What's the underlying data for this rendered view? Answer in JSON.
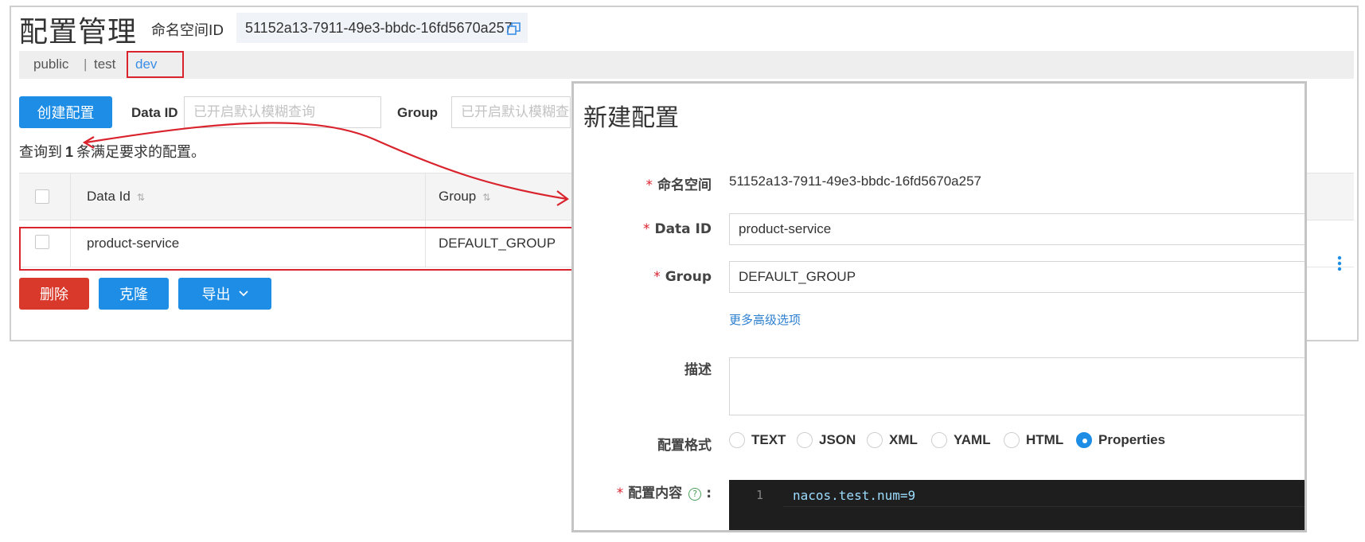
{
  "page": {
    "title": "配置管理",
    "namespace_label": "命名空间ID",
    "namespace_id": "51152a13-7911-49e3-bbdc-16fd5670a257"
  },
  "namespace_tabs": [
    {
      "label": "public",
      "active": false
    },
    {
      "label": "test",
      "active": false
    },
    {
      "label": "dev",
      "active": true
    }
  ],
  "toolbar": {
    "create_button": "创建配置",
    "data_id_label": "Data ID",
    "data_id_placeholder": "已开启默认模糊查询",
    "group_label": "Group",
    "group_placeholder": "已开启默认模糊查询"
  },
  "results": {
    "prefix": "查询到",
    "count": "1",
    "suffix": "条满足要求的配置。"
  },
  "table": {
    "headers": [
      "Data Id",
      "Group"
    ],
    "rows": [
      {
        "data_id": "product-service",
        "group": "DEFAULT_GROUP"
      }
    ]
  },
  "bulk_actions": {
    "delete": "删除",
    "clone": "克隆",
    "export": "导出"
  },
  "dialog": {
    "title": "新建配置",
    "namespace_label": "命名空间",
    "namespace_value": "51152a13-7911-49e3-bbdc-16fd5670a257",
    "data_id_label": "Data ID",
    "data_id_value": "product-service",
    "group_label": "Group",
    "group_value": "DEFAULT_GROUP",
    "advanced_link": "更多高级选项",
    "description_label": "描述",
    "format_label": "配置格式",
    "formats": [
      "TEXT",
      "JSON",
      "XML",
      "YAML",
      "HTML",
      "Properties"
    ],
    "selected_format": "Properties",
    "content_label": "配置内容",
    "content_colon": ":",
    "help_symbol": "?",
    "editor": {
      "line_number": "1",
      "line_text": "nacos.test.num=9"
    }
  },
  "icons": {
    "copy": "copy-icon",
    "sort": "sort-icon",
    "chevron": "chevron-down-icon",
    "more": "more-vertical-icon",
    "help": "help-circle-icon"
  },
  "colors": {
    "primary": "#1d8de5",
    "danger": "#d9392b",
    "annotation": "#d9232d",
    "active_tab": "#3a8ee6"
  }
}
